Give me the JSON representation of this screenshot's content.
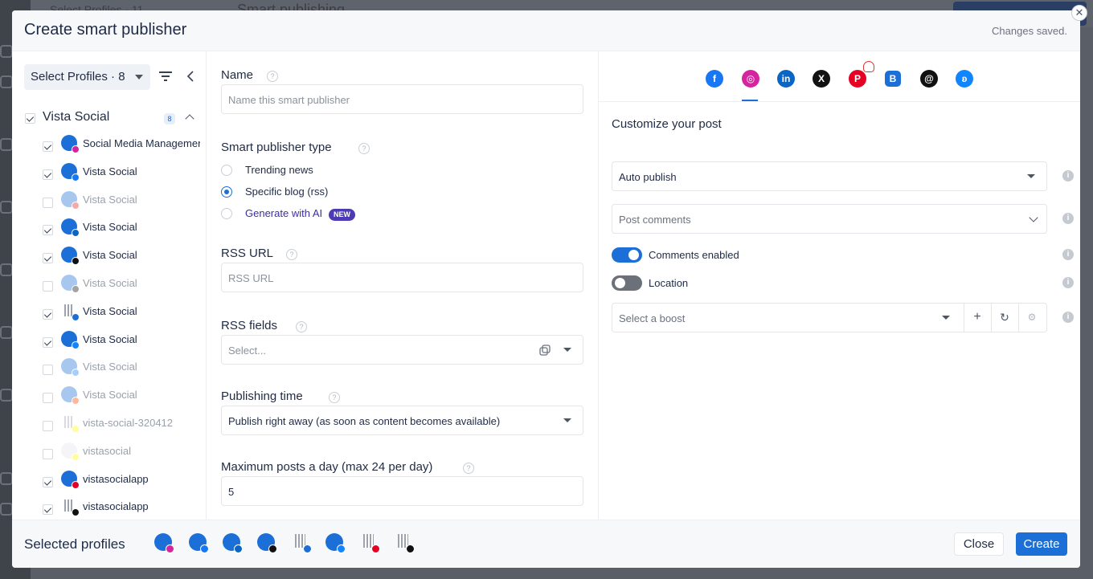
{
  "background": {
    "profiles_label": "Select Profiles · 11",
    "page_title": "Smart publishing"
  },
  "modal": {
    "title": "Create smart publisher",
    "status": "Changes saved.",
    "close_icon": "close-icon"
  },
  "left": {
    "profile_select": "Select Profiles · 8",
    "group": {
      "label": "Vista Social",
      "count": "8",
      "checked": true
    },
    "profiles": [
      {
        "name": "Social Media Management",
        "checked": true,
        "dim": false,
        "avatar": "blue",
        "network": "instagram",
        "net_color": "#d6249f"
      },
      {
        "name": "Vista Social",
        "checked": true,
        "dim": false,
        "avatar": "blue",
        "network": "facebook",
        "net_color": "#1877f2"
      },
      {
        "name": "Vista Social",
        "checked": false,
        "dim": true,
        "avatar": "blue",
        "network": "youtube",
        "net_color": "#e62117"
      },
      {
        "name": "Vista Social",
        "checked": true,
        "dim": false,
        "avatar": "blue",
        "network": "linkedin",
        "net_color": "#0a66c2"
      },
      {
        "name": "Vista Social",
        "checked": true,
        "dim": false,
        "avatar": "blue",
        "network": "x",
        "net_color": "#111111"
      },
      {
        "name": "Vista Social",
        "checked": false,
        "dim": true,
        "avatar": "blue",
        "network": "tiktok",
        "net_color": "#111111"
      },
      {
        "name": "Vista Social",
        "checked": true,
        "dim": false,
        "avatar": "building",
        "network": "google-business",
        "net_color": "#1b6fd6"
      },
      {
        "name": "Vista Social",
        "checked": true,
        "dim": false,
        "avatar": "blue",
        "network": "bluesky",
        "net_color": "#1185fe"
      },
      {
        "name": "Vista Social",
        "checked": false,
        "dim": true,
        "avatar": "blue",
        "network": "bluesky",
        "net_color": "#1185fe"
      },
      {
        "name": "Vista Social",
        "checked": false,
        "dim": true,
        "avatar": "blue",
        "network": "reddit",
        "net_color": "#ff4500"
      },
      {
        "name": "vista-social-320412",
        "checked": false,
        "dim": true,
        "avatar": "building",
        "network": "snapchat",
        "net_color": "#fffc00"
      },
      {
        "name": "vistasocial",
        "checked": false,
        "dim": true,
        "avatar": "person",
        "network": "snapchat",
        "net_color": "#fffc00"
      },
      {
        "name": "vistasocialapp",
        "checked": true,
        "dim": false,
        "avatar": "blue",
        "network": "pinterest",
        "net_color": "#e60023"
      },
      {
        "name": "vistasocialapp",
        "checked": true,
        "dim": false,
        "avatar": "building",
        "network": "threads",
        "net_color": "#111111"
      }
    ]
  },
  "form": {
    "name_label": "Name",
    "name_placeholder": "Name this smart publisher",
    "type_label": "Smart publisher type",
    "types": [
      {
        "label": "Trending news",
        "selected": false
      },
      {
        "label": "Specific blog (rss)",
        "selected": true
      },
      {
        "label": "Generate with AI",
        "selected": false
      }
    ],
    "new_badge": "NEW",
    "rss_url_label": "RSS URL",
    "rss_url_placeholder": "RSS URL",
    "rss_fields_label": "RSS fields",
    "rss_fields_placeholder": "Select...",
    "publishing_time_label": "Publishing time",
    "publishing_time_value": "Publish right away (as soon as content becomes available)",
    "max_posts_label": "Maximum posts a day (max 24 per day)",
    "max_posts_value": "5"
  },
  "customize": {
    "networks": [
      {
        "icon": "facebook-icon",
        "glyph": "f",
        "color": "#1877f2"
      },
      {
        "icon": "instagram-icon",
        "glyph": "◎",
        "color": "#d6249f"
      },
      {
        "icon": "linkedin-icon",
        "glyph": "in",
        "color": "#0a66c2"
      },
      {
        "icon": "x-icon",
        "glyph": "X",
        "color": "#111111"
      },
      {
        "icon": "pinterest-icon",
        "glyph": "P",
        "color": "#e60023"
      },
      {
        "icon": "google-business-icon",
        "glyph": "B",
        "color": "#1b6fd6"
      },
      {
        "icon": "threads-icon",
        "glyph": "@",
        "color": "#111111"
      },
      {
        "icon": "bluesky-icon",
        "glyph": "ʚ",
        "color": "#1185fe"
      }
    ],
    "active_network": "instagram",
    "title": "Customize your post",
    "publish_mode": "Auto publish",
    "post_comments_placeholder": "Post comments",
    "comments_label": "Comments enabled",
    "comments_enabled": true,
    "location_label": "Location",
    "location_enabled": false,
    "boost_placeholder": "Select a boost"
  },
  "footer": {
    "selected_label": "Selected profiles",
    "selected": [
      {
        "avatar": "blue",
        "network": "instagram",
        "net_color": "#d6249f"
      },
      {
        "avatar": "blue",
        "network": "facebook",
        "net_color": "#1877f2"
      },
      {
        "avatar": "blue",
        "network": "linkedin",
        "net_color": "#0a66c2"
      },
      {
        "avatar": "blue",
        "network": "x",
        "net_color": "#111111"
      },
      {
        "avatar": "building",
        "network": "google-business",
        "net_color": "#1b6fd6"
      },
      {
        "avatar": "blue",
        "network": "bluesky",
        "net_color": "#1185fe"
      },
      {
        "avatar": "building",
        "network": "pinterest",
        "net_color": "#e60023"
      },
      {
        "avatar": "building",
        "network": "threads",
        "net_color": "#111111"
      }
    ],
    "close_label": "Close",
    "create_label": "Create"
  },
  "colors": {
    "accent": "#1b6fd6",
    "new_badge": "#4c3bb5"
  }
}
